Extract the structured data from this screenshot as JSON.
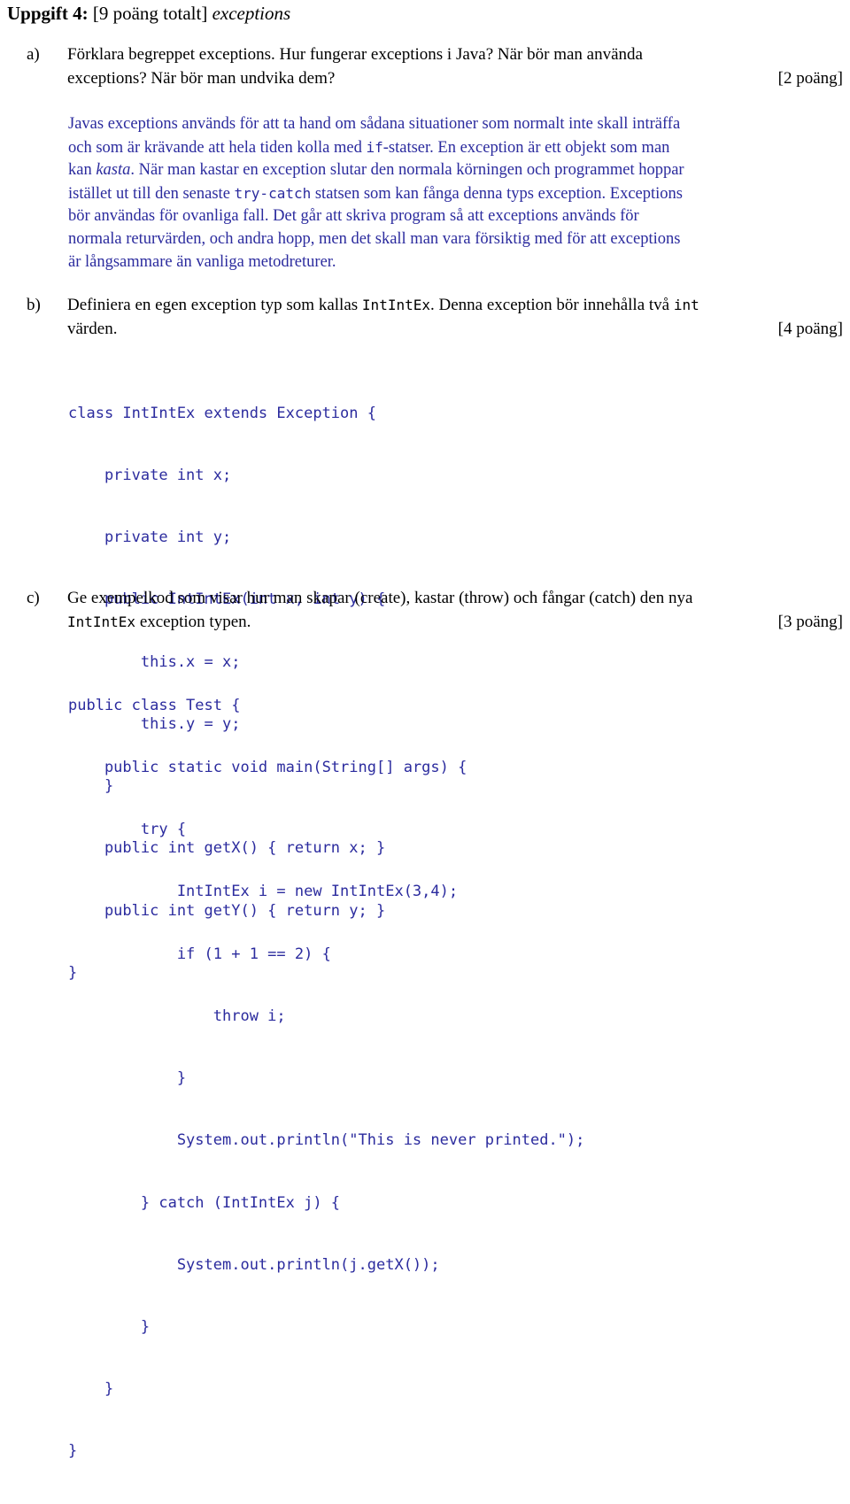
{
  "document": {
    "title": {
      "bold": "Uppgift 4:",
      "regular": " [9 poäng totalt] ",
      "italic": "exceptions"
    },
    "text_color": "#000000",
    "answer_color": "#2b2b9e"
  },
  "questions": [
    {
      "marker": "a)",
      "points": "[2 poäng]",
      "lines": [
        "Förklara begreppet exceptions. Hur fungerar exceptions i Java? När bör man använda",
        "exceptions? När bör man undvika dem?"
      ]
    },
    {
      "marker": "b)",
      "points": "[4 poäng]",
      "line1_a": "Definiera en egen exception typ som kallas ",
      "line1_mono1": "IntIntEx",
      "line1_b": ". Denna exception bör innehålla två ",
      "line1_mono2": "int",
      "line2": "värden."
    },
    {
      "marker": "c)",
      "points": "[3 poäng]",
      "line1": "Ge exempelkod som visar hur man skapar (create), kastar (throw) och fångar (catch) den nya",
      "line2_mono": "IntIntEx",
      "line2_b": " exception typen."
    }
  ],
  "answer_a": {
    "l1": "Javas exceptions används för att ta hand om sådana situationer som normalt inte skall inträffa",
    "l2_a": "och som är krävande att hela tiden kolla med ",
    "l2_mono": "if",
    "l2_b": "-statser. En exception är ett objekt som man",
    "l3_a": "kan ",
    "l3_ital": "kasta",
    "l3_b": ". När man kastar en exception slutar den normala körningen och programmet hoppar",
    "l4_a": "istället ut till den senaste ",
    "l4_mono": "try-catch",
    "l4_b": " statsen som kan fånga denna typs exception. Exceptions",
    "l5": "bör användas för ovanliga fall. Det går att skriva program så att exceptions används för",
    "l6": "normala returvärden, och andra hopp, men det skall man vara försiktig med för att exceptions",
    "l7": "är långsammare än vanliga metodreturer."
  },
  "code_b": [
    "class IntIntEx extends Exception {",
    "    private int x;",
    "    private int y;",
    "    public IntIntEx(int x, int y) {",
    "        this.x = x;",
    "        this.y = y;",
    "    }",
    "    public int getX() { return x; }",
    "    public int getY() { return y; }",
    "}"
  ],
  "code_c": [
    "public class Test {",
    "    public static void main(String[] args) {",
    "        try {",
    "            IntIntEx i = new IntIntEx(3,4);",
    "            if (1 + 1 == 2) {",
    "                throw i;",
    "            }",
    "            System.out.println(\"This is never printed.\");",
    "        } catch (IntIntEx j) {",
    "            System.out.println(j.getX());",
    "        }",
    "    }",
    "}"
  ]
}
